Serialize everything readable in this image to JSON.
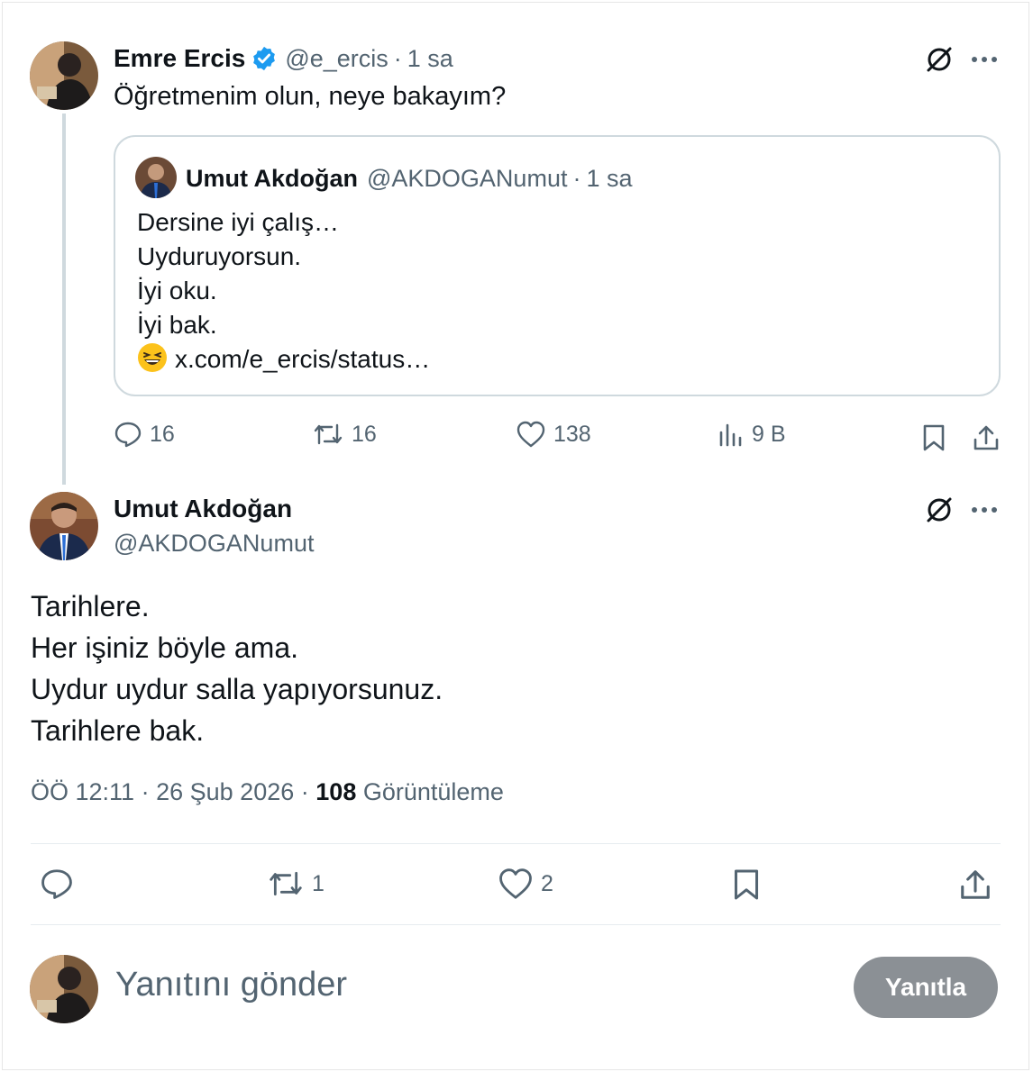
{
  "parent_tweet": {
    "author_name": "Emre Ercis",
    "handle": "@e_ercis",
    "separator": "·",
    "time": "1 sa",
    "text": "Öğretmenim olun, neye bakayım?",
    "verified": true,
    "quote": {
      "author_name": "Umut Akdoğan",
      "handle": "@AKDOGANumut",
      "separator": "·",
      "time": "1 sa",
      "lines": [
        "Dersine iyi çalış…",
        "Uyduruyorsun.",
        "İyi oku.",
        "İyi bak."
      ],
      "link": "x.com/e_ercis/status…",
      "emoji_icon": "grinning-squinting-face-emoji"
    },
    "actions": {
      "replies": "16",
      "reposts": "16",
      "likes": "138",
      "views": "9 B"
    }
  },
  "main_tweet": {
    "author_name": "Umut Akdoğan",
    "handle": "@AKDOGANumut",
    "lines": [
      "Tarihlere.",
      "Her işiniz böyle ama.",
      "Uydur uydur salla yapıyorsunuz.",
      "Tarihlere bak."
    ],
    "time": "ÖÖ 12:11",
    "date": "26 Şub 2026",
    "separator": "·",
    "views_count": "108",
    "views_label": "Görüntüleme",
    "actions": {
      "reposts": "1",
      "likes": "2"
    }
  },
  "reply_box": {
    "placeholder": "Yanıtını gönder",
    "button_label": "Yanıtla"
  },
  "colors": {
    "text": "#0f1419",
    "muted": "#536471",
    "verified": "#1d9bf0",
    "border": "#cfd9de",
    "reply_button": "#8b9095"
  }
}
